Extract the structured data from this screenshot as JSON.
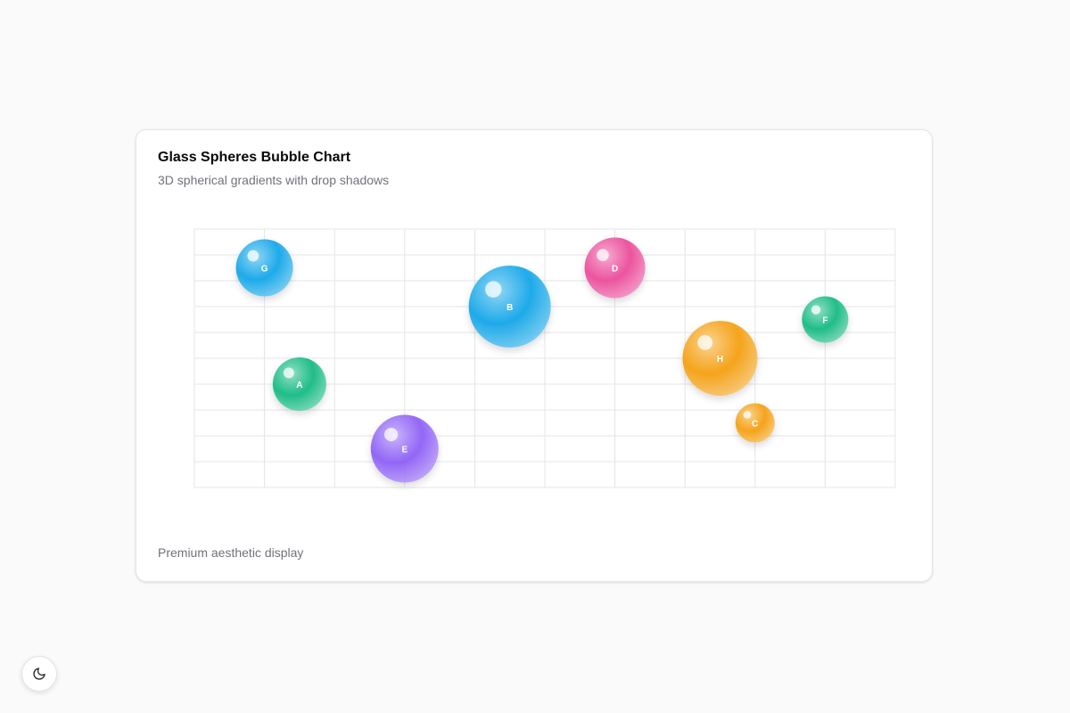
{
  "card": {
    "title": "Glass Spheres Bubble Chart",
    "subtitle": "3D spherical gradients with drop shadows",
    "footer": "Premium aesthetic display"
  },
  "theme_toggle": {
    "icon": "moon-icon"
  },
  "colors": {
    "blue": "#0ea5e9",
    "green": "#10b981",
    "orange": "#f59e0b",
    "pink": "#ec4899",
    "purple": "#8b5cf6",
    "grid": "#e4e4e7"
  },
  "chart_data": {
    "type": "scatter",
    "title": "",
    "xlabel": "",
    "ylabel": "",
    "xlim": [
      0,
      10
    ],
    "ylim": [
      0,
      10
    ],
    "grid": true,
    "points": [
      {
        "label": "G",
        "x": 1.0,
        "y": 8.5,
        "size": 32,
        "color": "#0ea5e9"
      },
      {
        "label": "A",
        "x": 1.5,
        "y": 4.0,
        "size": 30,
        "color": "#10b981"
      },
      {
        "label": "E",
        "x": 3.0,
        "y": 1.5,
        "size": 38,
        "color": "#8b5cf6"
      },
      {
        "label": "B",
        "x": 4.5,
        "y": 7.0,
        "size": 46,
        "color": "#0ea5e9"
      },
      {
        "label": "D",
        "x": 6.0,
        "y": 8.5,
        "size": 34,
        "color": "#ec4899"
      },
      {
        "label": "H",
        "x": 7.5,
        "y": 5.0,
        "size": 42,
        "color": "#f59e0b"
      },
      {
        "label": "C",
        "x": 8.0,
        "y": 2.5,
        "size": 22,
        "color": "#f59e0b"
      },
      {
        "label": "F",
        "x": 9.0,
        "y": 6.5,
        "size": 26,
        "color": "#10b981"
      }
    ]
  }
}
